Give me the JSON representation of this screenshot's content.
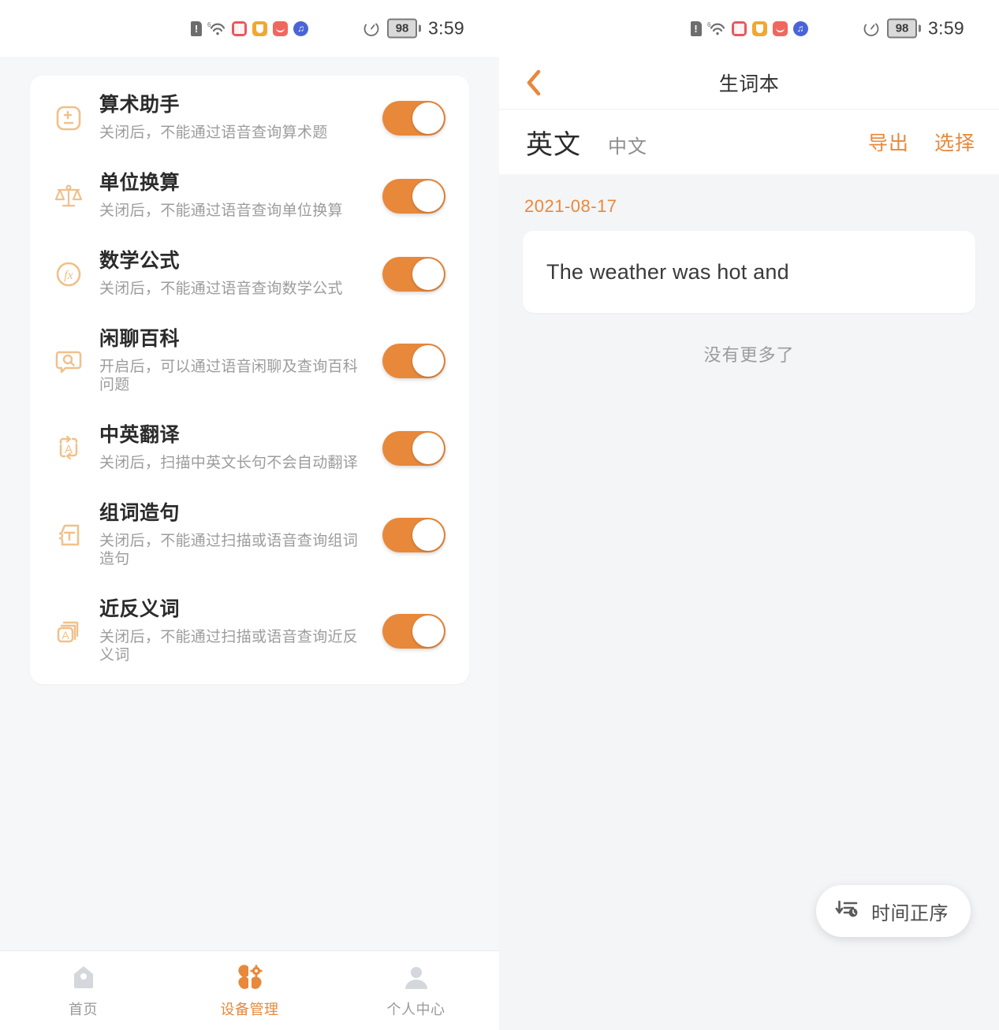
{
  "status_bar": {
    "time": "3:59",
    "battery_level": "98",
    "icons": [
      "sim-alert-icon",
      "wifi-6-icon",
      "book-app-icon",
      "cup-app-icon",
      "mail-app-icon",
      "music-app-icon"
    ],
    "right_icons": [
      "speed-meter-icon",
      "battery-icon"
    ]
  },
  "colors": {
    "accent": "#e8883a",
    "page_bg": "#f6f7f9",
    "card_bg": "#ffffff",
    "title_text": "#2b2b2b",
    "sub_text": "#9c9c9c"
  },
  "left_panel": {
    "settings": [
      {
        "icon": "calculator-icon",
        "title": "算术助手",
        "subtitle": "关闭后，不能通过语音查询算术题",
        "enabled": true
      },
      {
        "icon": "balance-scale-icon",
        "title": "单位换算",
        "subtitle": "关闭后，不能通过语音查询单位换算",
        "enabled": true
      },
      {
        "icon": "fx-formula-icon",
        "title": "数学公式",
        "subtitle": "关闭后，不能通过语音查询数学公式",
        "enabled": true
      },
      {
        "icon": "chat-search-icon",
        "title": "闲聊百科",
        "subtitle": "开启后，可以通过语音闲聊及查询百科问题",
        "enabled": true
      },
      {
        "icon": "translate-icon",
        "title": "中英翻译",
        "subtitle": "关闭后，扫描中英文长句不会自动翻译",
        "enabled": true
      },
      {
        "icon": "compose-sentence-icon",
        "title": "组词造句",
        "subtitle": "关闭后，不能通过扫描或语音查询组词造句",
        "enabled": true
      },
      {
        "icon": "synonym-cards-icon",
        "title": "近反义词",
        "subtitle": "关闭后，不能通过扫描或语音查询近反义词",
        "enabled": true
      }
    ],
    "tabbar": [
      {
        "icon": "home-icon",
        "label": "首页",
        "active": false
      },
      {
        "icon": "device-manage-icon",
        "label": "设备管理",
        "active": true
      },
      {
        "icon": "person-icon",
        "label": "个人中心",
        "active": false
      }
    ]
  },
  "right_panel": {
    "header": {
      "back_icon": "chevron-left-icon",
      "title": "生词本"
    },
    "subnav": {
      "tab_active": "英文",
      "tab_inactive": "中文",
      "export_label": "导出",
      "select_label": "选择"
    },
    "groups": [
      {
        "date": "2021-08-17",
        "entries": [
          {
            "text": "The weather was hot and"
          }
        ]
      }
    ],
    "no_more_label": "没有更多了",
    "sort_button": {
      "icon": "sort-time-icon",
      "label": "时间正序"
    }
  }
}
